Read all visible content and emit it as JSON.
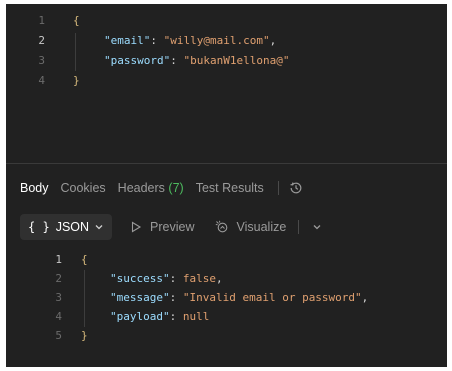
{
  "request_body": {
    "line_numbers": [
      "1",
      "2",
      "3",
      "4"
    ],
    "lines": [
      {
        "open_brace": "{"
      },
      {
        "key": "\"email\"",
        "colon": ": ",
        "value": "\"willy@mail.com\"",
        "trail": ","
      },
      {
        "key": "\"password\"",
        "colon": ": ",
        "value": "\"bukanW1ellona@\"",
        "trail": ""
      },
      {
        "close_brace": "}"
      }
    ]
  },
  "response_tabs": {
    "body": "Body",
    "cookies": "Cookies",
    "headers": "Headers",
    "headers_count": "(7)",
    "test_results": "Test Results"
  },
  "toolbar": {
    "format_icon": "{ }",
    "format_label": "JSON",
    "preview_label": "Preview",
    "visualize_label": "Visualize"
  },
  "response_body": {
    "line_numbers": [
      "1",
      "2",
      "3",
      "4",
      "5"
    ],
    "open_brace": "{",
    "close_brace": "}",
    "success_key": "\"success\"",
    "success_value": "false",
    "message_key": "\"message\"",
    "message_value": "\"Invalid email or password\"",
    "payload_key": "\"payload\"",
    "payload_value": "null",
    "colon": ": ",
    "comma": ","
  },
  "colors": {
    "background": "#212121",
    "key": "#9cdcfe",
    "string": "#e0a070",
    "count_green": "#4dbb5f"
  },
  "icons": [
    "history-icon",
    "chevron-down-icon",
    "play-outline-icon",
    "visualize-icon"
  ]
}
